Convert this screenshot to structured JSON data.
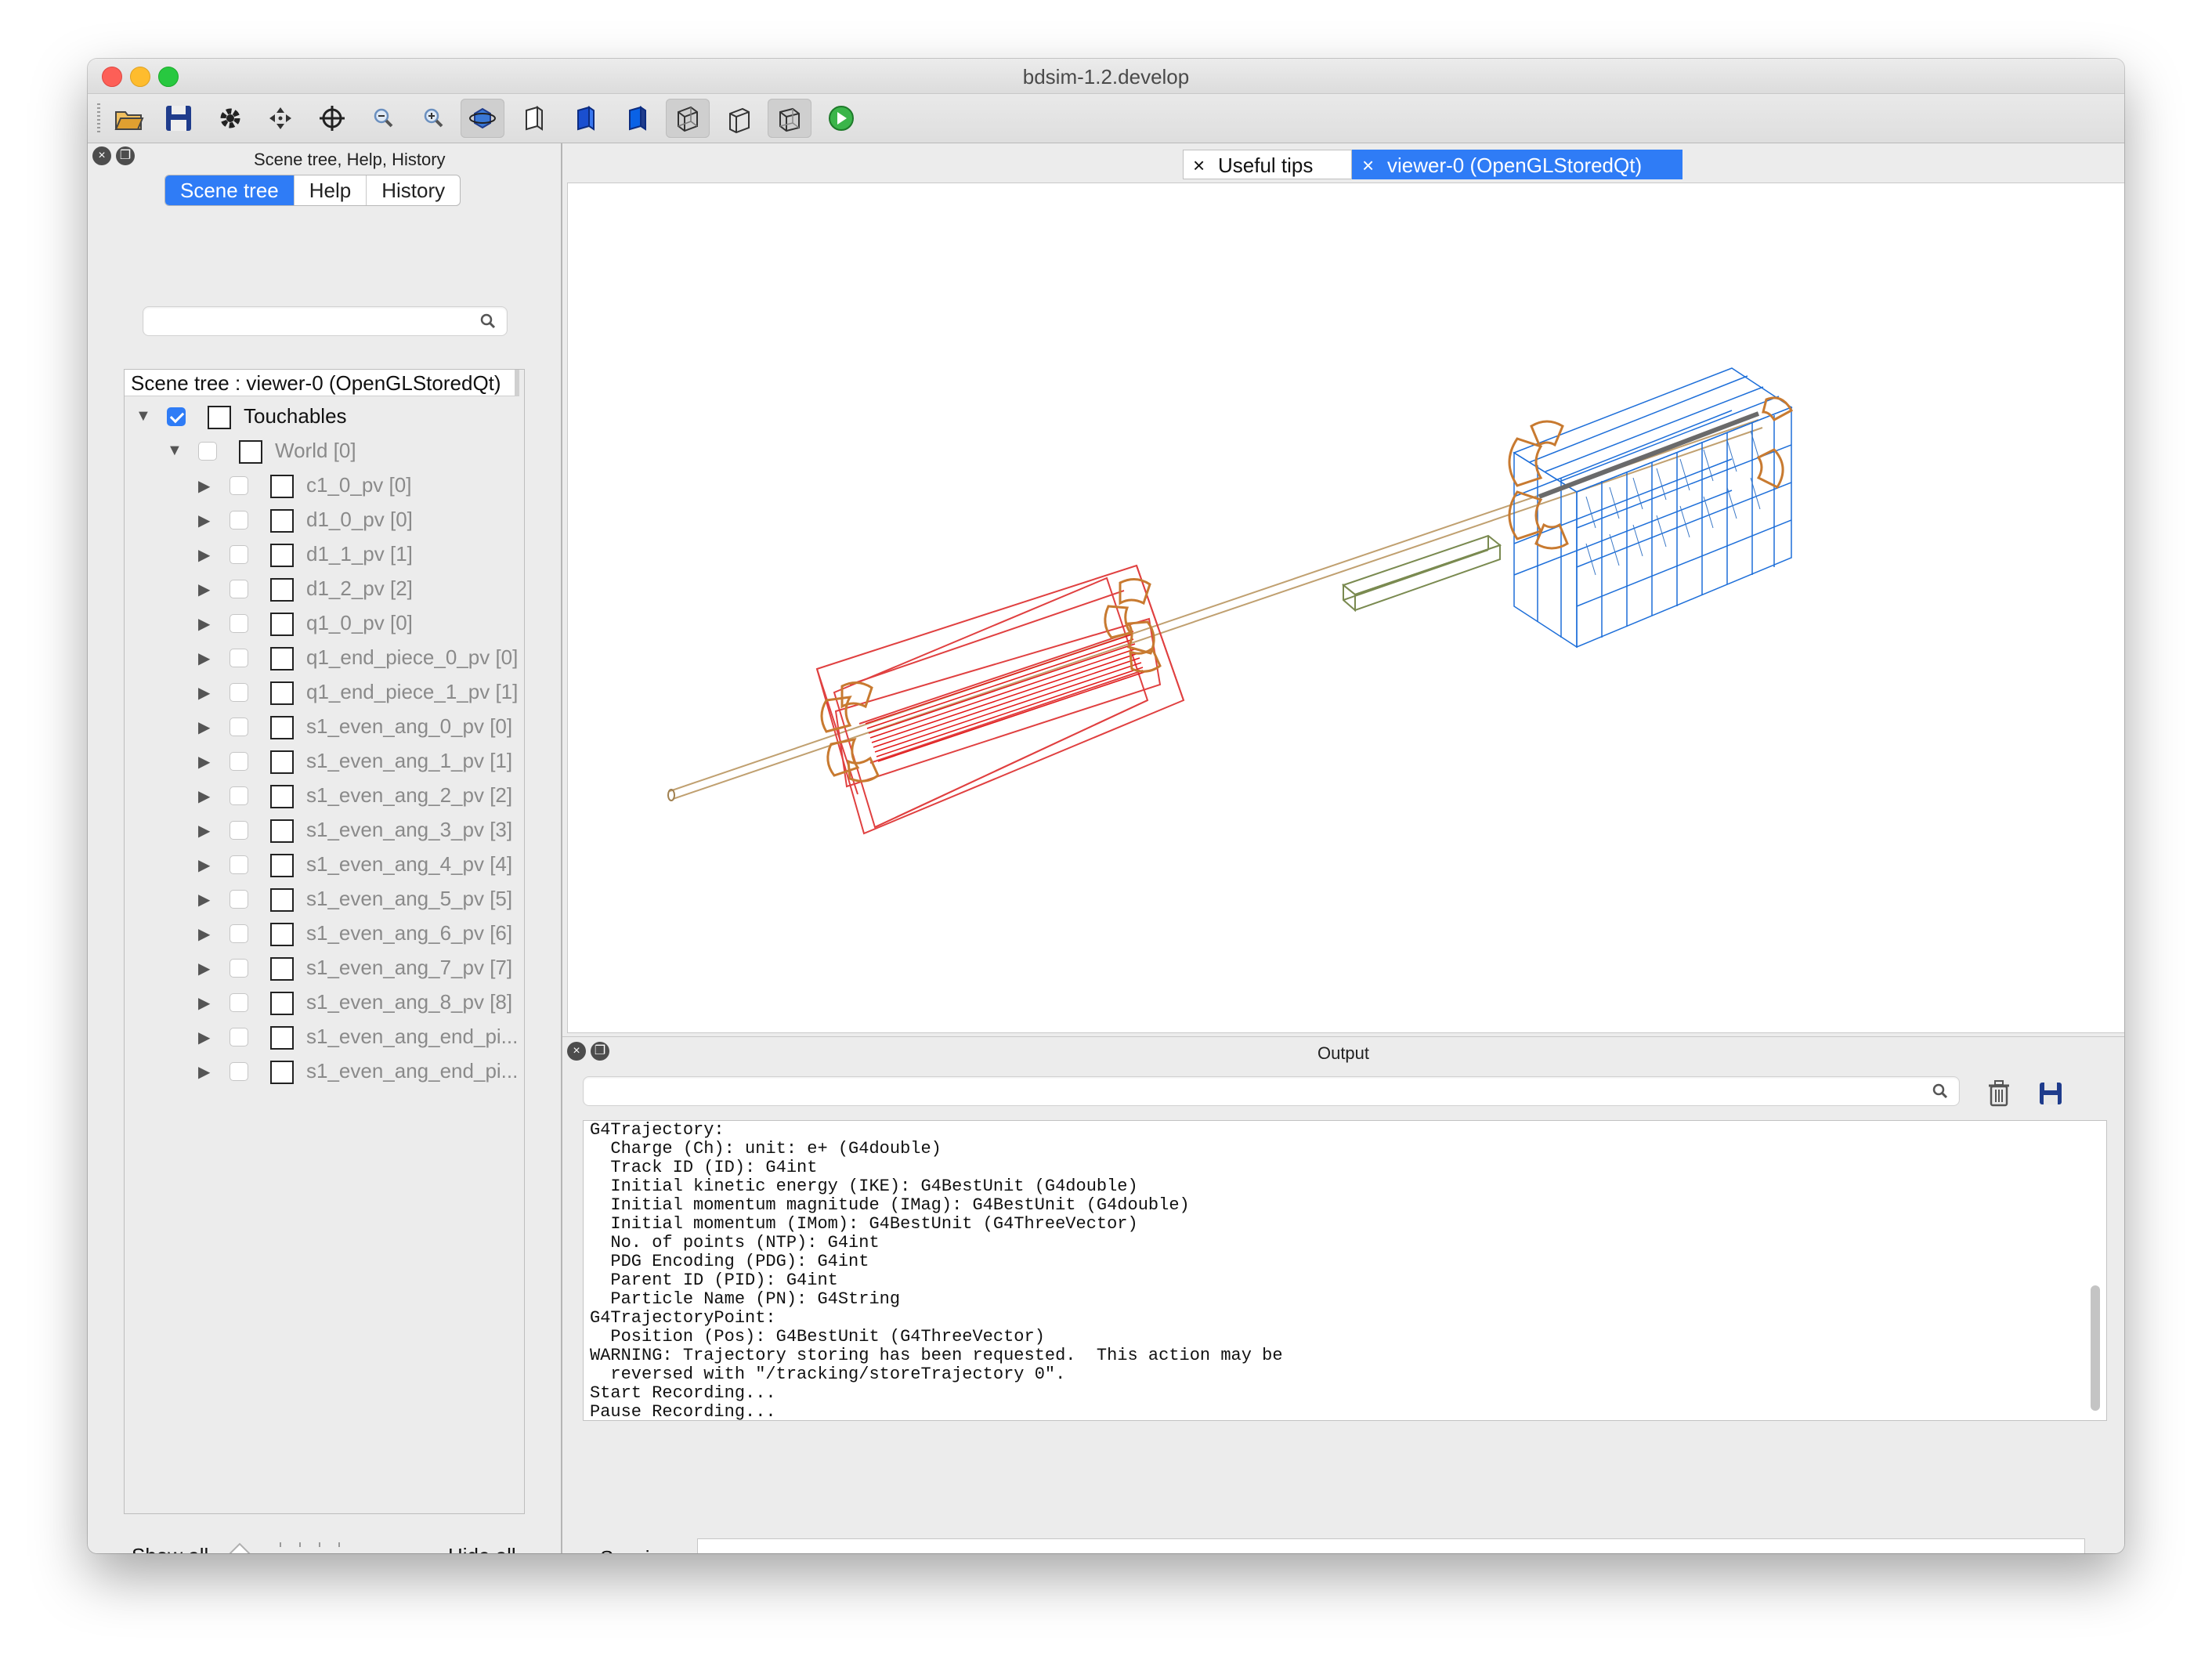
{
  "window": {
    "title": "bdsim-1.2.develop"
  },
  "toolbar": {
    "buttons": [
      {
        "name": "open-folder-icon",
        "active": false
      },
      {
        "name": "save-icon",
        "active": false
      },
      {
        "name": "settings-icon",
        "active": false
      },
      {
        "name": "move-icon",
        "active": false
      },
      {
        "name": "pick-target-icon",
        "active": false
      },
      {
        "name": "zoom-out-icon",
        "active": false
      },
      {
        "name": "zoom-in-icon",
        "active": false
      },
      {
        "name": "rotate-icon",
        "active": true
      },
      {
        "name": "hidden-line-icon",
        "active": false
      },
      {
        "name": "solid-icon",
        "active": false
      },
      {
        "name": "solid-shaded-icon",
        "active": false
      },
      {
        "name": "wireframe-icon",
        "active": true
      },
      {
        "name": "perspective-icon",
        "active": false
      },
      {
        "name": "ortho-icon",
        "active": true
      },
      {
        "name": "run-icon",
        "active": false
      }
    ]
  },
  "left_dock": {
    "title": "Scene tree, Help, History",
    "tabs": [
      {
        "label": "Scene tree",
        "active": true
      },
      {
        "label": "Help",
        "active": false
      },
      {
        "label": "History",
        "active": false
      }
    ],
    "search": {
      "value": "",
      "placeholder": ""
    },
    "tree_header": "Scene tree : viewer-0 (OpenGLStoredQt)",
    "tree": [
      {
        "label": "Touchables",
        "level": 0,
        "checked": true,
        "dark": true
      },
      {
        "label": "World [0]",
        "level": 1,
        "checked": false,
        "dark": false
      },
      {
        "label": "c1_0_pv [0]",
        "level": 2
      },
      {
        "label": "d1_0_pv [0]",
        "level": 2
      },
      {
        "label": "d1_1_pv [1]",
        "level": 2
      },
      {
        "label": "d1_2_pv [2]",
        "level": 2
      },
      {
        "label": "q1_0_pv [0]",
        "level": 2
      },
      {
        "label": "q1_end_piece_0_pv [0]",
        "level": 2
      },
      {
        "label": "q1_end_piece_1_pv [1]",
        "level": 2
      },
      {
        "label": "s1_even_ang_0_pv [0]",
        "level": 2
      },
      {
        "label": "s1_even_ang_1_pv [1]",
        "level": 2
      },
      {
        "label": "s1_even_ang_2_pv [2]",
        "level": 2
      },
      {
        "label": "s1_even_ang_3_pv [3]",
        "level": 2
      },
      {
        "label": "s1_even_ang_4_pv [4]",
        "level": 2
      },
      {
        "label": "s1_even_ang_5_pv [5]",
        "level": 2
      },
      {
        "label": "s1_even_ang_6_pv [6]",
        "level": 2
      },
      {
        "label": "s1_even_ang_7_pv [7]",
        "level": 2
      },
      {
        "label": "s1_even_ang_8_pv [8]",
        "level": 2
      },
      {
        "label": "s1_even_ang_end_pi...",
        "level": 2
      },
      {
        "label": "s1_even_ang_end_pi...",
        "level": 2
      }
    ],
    "show_all": "Show all",
    "hide_all": "Hide all",
    "slider_value": 0
  },
  "viewer_tabs": [
    {
      "label": "Useful tips",
      "active": false
    },
    {
      "label": "viewer-0 (OpenGLStoredQt)",
      "active": true
    }
  ],
  "output": {
    "title": "Output",
    "search": {
      "value": "",
      "placeholder": ""
    },
    "lines": [
      "G4Trajectory:",
      "  Charge (Ch): unit: e+ (G4double)",
      "  Track ID (ID): G4int",
      "  Initial kinetic energy (IKE): G4BestUnit (G4double)",
      "  Initial momentum magnitude (IMag): G4BestUnit (G4double)",
      "  Initial momentum (IMom): G4BestUnit (G4ThreeVector)",
      "  No. of points (NTP): G4int",
      "  PDG Encoding (PDG): G4int",
      "  Parent ID (PID): G4int",
      "  Particle Name (PN): G4String",
      "G4TrajectoryPoint:",
      "  Position (Pos): G4BestUnit (G4ThreeVector)",
      "WARNING: Trajectory storing has been requested.  This action may be",
      "  reversed with \"/tracking/storeTrajectory 0\".",
      "Start Recording...",
      "Pause Recording..."
    ],
    "session_label": "Session :",
    "session_value": ""
  },
  "colors": {
    "accent": "#2f7cf6",
    "quad_wire": "#e02020",
    "coil_wire": "#c87a30",
    "sector_wire": "#1e6fd9",
    "drift_wire": "#7a8a50"
  }
}
